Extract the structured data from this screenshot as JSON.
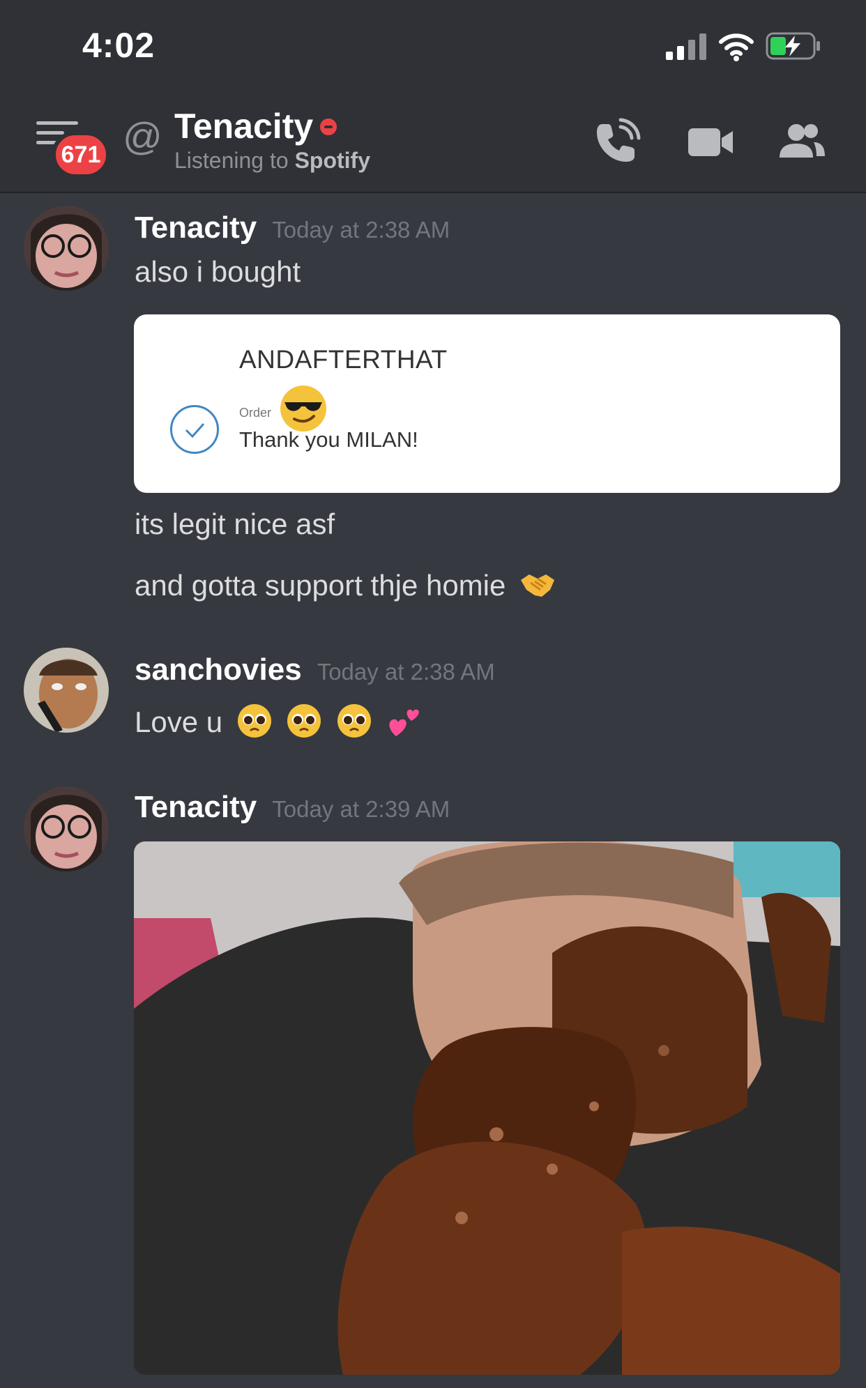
{
  "status_bar": {
    "time": "4:02"
  },
  "header": {
    "unread_count": "671",
    "at_symbol": "@",
    "channel_name": "Tenacity",
    "activity_prefix": "Listening to",
    "activity_app": "Spotify"
  },
  "colors": {
    "background": "#36393f",
    "header": "#2f3136",
    "mention_badge": "#ed4245",
    "status_dnd": "#ed4245",
    "battery_charge": "#30d158",
    "order_check": "#3f87c4"
  },
  "messages": [
    {
      "author": "Tenacity",
      "timestamp": "Today at 2:38 AM",
      "lines": [
        "also i bought",
        "its legit nice asf",
        "and gotta support thje homie"
      ],
      "embed": {
        "shop_name": "ANDAFTERTHAT",
        "order_label": "Order",
        "thank_you": "Thank you MILAN!",
        "sticker": "sunglasses-emoji",
        "icon": "checkmark-circle-icon"
      },
      "trailing_emoji": "handshake-emoji"
    },
    {
      "author": "sanchovies",
      "timestamp": "Today at 2:38 AM",
      "text": "Love u",
      "emojis": [
        "pleading-face-emoji",
        "pleading-face-emoji",
        "pleading-face-emoji",
        "two-hearts-emoji"
      ]
    },
    {
      "author": "Tenacity",
      "timestamp": "Today at 2:39 AM",
      "attachment": "gif-image"
    }
  ]
}
